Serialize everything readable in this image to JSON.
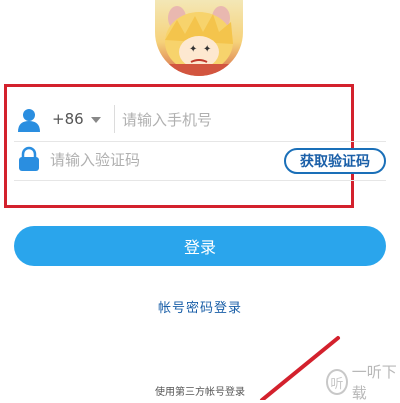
{
  "form": {
    "country_code": "+86",
    "phone_placeholder": "请输入手机号",
    "code_placeholder": "请输入验证码",
    "get_code_label": "获取验证码"
  },
  "login_label": "登录",
  "password_login_link": "帐号密码登录",
  "third_party_label": "使用第三方帐号登录",
  "watermark": {
    "badge": "听",
    "text": "一听下载"
  },
  "colors": {
    "accent": "#2aa5ec",
    "link": "#1a5fa8",
    "highlight_box": "#d3212d"
  },
  "icons": [
    "user-avatar",
    "person-icon",
    "chevron-down-icon",
    "lock-icon",
    "annotation-arrow"
  ]
}
